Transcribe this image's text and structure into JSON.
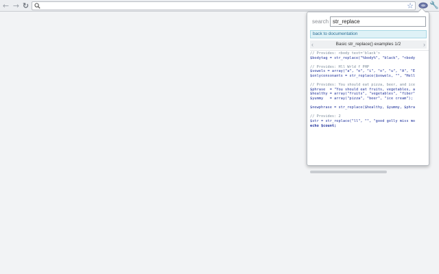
{
  "toolbar": {
    "back_icon": "←",
    "forward_icon": "→",
    "reload_icon": "↻",
    "url": "",
    "star_icon": "☆",
    "wrench_icon": "🔧"
  },
  "popup": {
    "search_label": "search",
    "search_value": "str_replace",
    "back_link": "back to documentation",
    "example_title": "Basic str_replace() examples 1/2",
    "prev_icon": "‹",
    "next_icon": "›",
    "code_lines": [
      {
        "cls": "c-comment",
        "text": "// Provides: <body text='black'>"
      },
      {
        "cls": "c-var",
        "text": "$bodytag = str_replace(\"%body%\", \"black\", \"<body"
      },
      {
        "cls": "c-var",
        "text": ""
      },
      {
        "cls": "c-comment",
        "text": "// Provides: Hll Wrld f PHP"
      },
      {
        "cls": "c-var",
        "text": "$vowels = array(\"a\", \"e\", \"i\", \"o\", \"u\", \"A\", \"E"
      },
      {
        "cls": "c-var",
        "text": "$onlyconsonants = str_replace($vowels, \"\", \"Hell"
      },
      {
        "cls": "c-var",
        "text": ""
      },
      {
        "cls": "c-comment",
        "text": "// Provides: You should eat pizza, beer, and ice"
      },
      {
        "cls": "c-var",
        "text": "$phrase  = \"You should eat fruits, vegetables, a"
      },
      {
        "cls": "c-var",
        "text": "$healthy = array(\"fruits\", \"vegetables\", \"fiber\""
      },
      {
        "cls": "c-var",
        "text": "$yummy   = array(\"pizza\", \"beer\", \"ice cream\");"
      },
      {
        "cls": "c-var",
        "text": ""
      },
      {
        "cls": "c-var",
        "text": "$newphrase = str_replace($healthy, $yummy, $phra"
      },
      {
        "cls": "c-var",
        "text": ""
      },
      {
        "cls": "c-comment",
        "text": "// Provides: 2"
      },
      {
        "cls": "c-var",
        "text": "$str = str_replace(\"ll\", \"\", \"good golly miss mo"
      },
      {
        "cls": "c-kw",
        "text": "echo $count;"
      }
    ]
  }
}
